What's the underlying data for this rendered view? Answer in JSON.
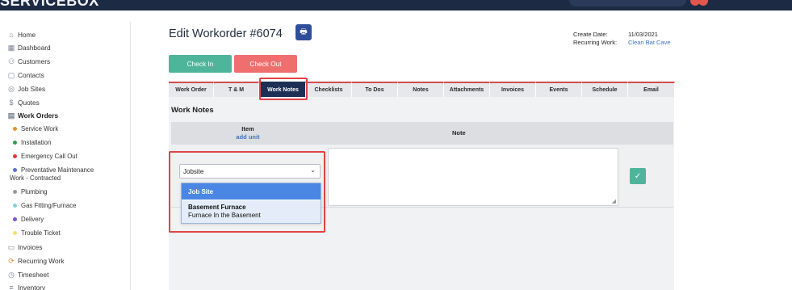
{
  "app": {
    "brand": "SERVICEBOX"
  },
  "sidebar": {
    "items": [
      {
        "label": "Home",
        "icon": "home-icon"
      },
      {
        "label": "Dashboard",
        "icon": "dashboard-icon"
      },
      {
        "label": "Customers",
        "icon": "customers-icon"
      },
      {
        "label": "Contacts",
        "icon": "contacts-icon"
      },
      {
        "label": "Job Sites",
        "icon": "location-icon"
      },
      {
        "label": "Quotes",
        "icon": "dollar-icon"
      },
      {
        "label": "Work Orders",
        "icon": "document-icon"
      }
    ],
    "work_order_types": [
      {
        "label": "Service Work",
        "color": "#f0932b"
      },
      {
        "label": "Installation",
        "color": "#2e9e4f"
      },
      {
        "label": "Emergency Call Out",
        "color": "#e03b3b"
      },
      {
        "label": "Preventative Maintenance",
        "label2": "Work - Contracted",
        "color": "#5a6fd8"
      },
      {
        "label": "Plumbing",
        "color": "#9a9a9a"
      },
      {
        "label": "Gas Fitting/Furnace",
        "color": "#7fd3d8"
      },
      {
        "label": "Delivery",
        "color": "#7b55d6"
      },
      {
        "label": "Trouble Ticket",
        "color": "#f3e36b"
      }
    ],
    "bottom_items": [
      {
        "label": "Invoices",
        "icon": "invoice-icon"
      },
      {
        "label": "Recurring Work",
        "icon": "recurring-icon"
      },
      {
        "label": "Timesheet",
        "icon": "stopwatch-icon"
      },
      {
        "label": "Inventory",
        "icon": "list-icon"
      }
    ]
  },
  "header": {
    "title": "Edit Workorder #6074",
    "create_date_label": "Create Date:",
    "create_date_value": "11/03/2021",
    "recurring_label": "Recurring Work:",
    "recurring_value": "Clean Bat Cave"
  },
  "actions": {
    "check_in": "Check In",
    "check_out": "Check Out"
  },
  "tabs": [
    "Work Order",
    "T & M",
    "Work Notes",
    "Checklists",
    "To Dos",
    "Notes",
    "Attachments",
    "Invoices",
    "Events",
    "Schedule",
    "Email"
  ],
  "active_tab": "Work Notes",
  "work_notes": {
    "title": "Work Notes",
    "col_item": "Item",
    "add_unit": "add unit",
    "col_note": "Note",
    "select_value": "Jobsite",
    "options": [
      {
        "title": "Job Site",
        "subtitle": ""
      },
      {
        "title": "Basement Furnace",
        "subtitle": "Furnace In the Basement"
      }
    ]
  },
  "colors": {
    "accent": "#1d2f55",
    "check_in": "#4fb59a",
    "check_out": "#ef6f6f",
    "link": "#3a73c7",
    "highlight_box": "#e04444"
  }
}
